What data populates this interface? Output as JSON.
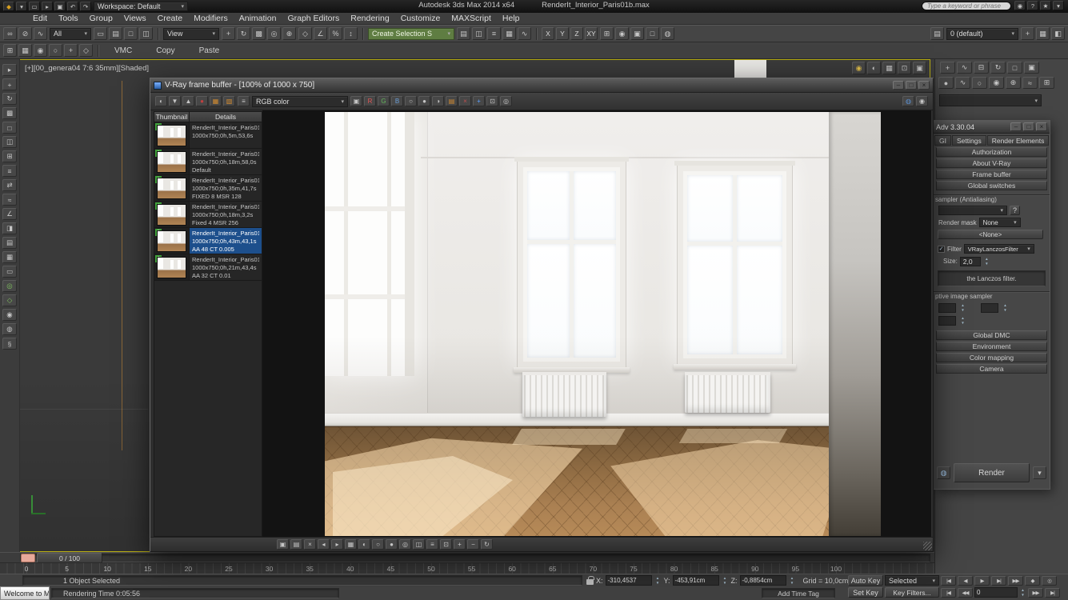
{
  "colors": {
    "viewport_active_border": "#b9ae12",
    "selection_highlight": "#1d4f8c",
    "history_badge": "#3fa03a",
    "time_slider_handle": "#e8a99a",
    "selection_set_green": "#5f7d42"
  },
  "titlebar": {
    "app_title": "Autodesk 3ds Max 2014 x64",
    "doc_title": "RenderIt_Interior_Paris01b.max",
    "workspace_label": "Workspace: Default",
    "search_placeholder": "Type a keyword or phrase",
    "quick_icons": [
      {
        "n": "max-logo-icon",
        "g": "◆",
        "c": "#d8a020"
      },
      {
        "n": "app-menu-arrow-icon",
        "g": "▾"
      },
      {
        "n": "new-scene-icon",
        "g": "▭"
      },
      {
        "n": "open-file-icon",
        "g": "▸"
      },
      {
        "n": "save-file-icon",
        "g": "▣"
      },
      {
        "n": "undo-icon",
        "g": "↶"
      },
      {
        "n": "redo-icon",
        "g": "↷"
      }
    ],
    "right_icons": [
      {
        "n": "sign-in-icon",
        "g": "◉"
      },
      {
        "n": "help-icon",
        "g": "?"
      },
      {
        "n": "favorites-icon",
        "g": "★"
      },
      {
        "n": "notifications-icon",
        "g": "▾"
      }
    ]
  },
  "menus": [
    "Edit",
    "Tools",
    "Group",
    "Views",
    "Create",
    "Modifiers",
    "Animation",
    "Graph Editors",
    "Rendering",
    "Customize",
    "MAXScript",
    "Help"
  ],
  "toolbar1": {
    "filter_dropdown": "All",
    "ref_coord_dropdown": "View",
    "selection_set_dropdown": "Create Selection S",
    "layer_dropdown": "0 (default)",
    "axis_buttons": [
      "X",
      "Y",
      "Z",
      "XY"
    ],
    "icons_a": [
      {
        "n": "select-and-link-icon",
        "g": "∞"
      },
      {
        "n": "unlink-selection-icon",
        "g": "⊘"
      },
      {
        "n": "bind-to-space-warp-icon",
        "g": "∿"
      }
    ],
    "icons_b": [
      {
        "n": "select-object-icon",
        "g": "▭"
      },
      {
        "n": "select-by-name-icon",
        "g": "▤"
      },
      {
        "n": "selection-region-icon",
        "g": "□"
      },
      {
        "n": "window-crossing-icon",
        "g": "◫"
      }
    ],
    "icons_c": [
      {
        "n": "select-and-move-icon",
        "g": "+"
      },
      {
        "n": "select-and-rotate-icon",
        "g": "↻"
      },
      {
        "n": "select-and-scale-icon",
        "g": "▩"
      },
      {
        "n": "use-pivot-center-icon",
        "g": "◎"
      },
      {
        "n": "select-and-manipulate-icon",
        "g": "⊕"
      }
    ],
    "icons_snap": [
      {
        "n": "snaps-toggle-icon",
        "g": "◇"
      },
      {
        "n": "angle-snap-icon",
        "g": "∠"
      },
      {
        "n": "percent-snap-icon",
        "g": "%"
      },
      {
        "n": "spinner-snap-icon",
        "g": "↕"
      }
    ],
    "icons_mid": [
      {
        "n": "edit-named-sets-icon",
        "g": "▤"
      },
      {
        "n": "mirror-icon",
        "g": "◫"
      },
      {
        "n": "align-icon",
        "g": "≡"
      },
      {
        "n": "layer-manager-icon",
        "g": "▦"
      },
      {
        "n": "curve-editor-icon",
        "g": "∿"
      }
    ],
    "icons_post": [
      {
        "n": "schematic-view-icon",
        "g": "⊞"
      },
      {
        "n": "material-editor-icon",
        "g": "◉"
      },
      {
        "n": "render-setup-icon",
        "g": "▣"
      },
      {
        "n": "render-frame-window-icon",
        "g": "□"
      },
      {
        "n": "render-production-icon",
        "g": "◍"
      }
    ],
    "right_icons_a": [
      {
        "n": "layer-list-icon",
        "g": "▤"
      }
    ],
    "right_icons_b": [
      {
        "n": "add-layer-icon",
        "g": "+"
      },
      {
        "n": "layer-properties-icon",
        "g": "▦"
      },
      {
        "n": "toggle-layer-icon",
        "g": "◧"
      }
    ]
  },
  "toolbar2": {
    "buttons": [
      "VMC",
      "Copy",
      "Paste"
    ],
    "icons": [
      {
        "n": "viewport-layout-icon",
        "g": "⊞"
      },
      {
        "n": "show-grid-icon",
        "g": "▦"
      },
      {
        "n": "camera-icon",
        "g": "◉"
      },
      {
        "n": "light-icon",
        "g": "○"
      },
      {
        "n": "helper-icon",
        "g": "+"
      },
      {
        "n": "systems-icon",
        "g": "◇"
      }
    ]
  },
  "leftstrip": {
    "icons": [
      {
        "n": "select-icon",
        "g": "▸"
      },
      {
        "n": "move-icon",
        "g": "+"
      },
      {
        "n": "rotate-icon",
        "g": "↻"
      },
      {
        "n": "scale-icon",
        "g": "▩"
      },
      {
        "n": "region-icon",
        "g": "□"
      },
      {
        "n": "mirror-icon",
        "g": "◫"
      },
      {
        "n": "array-icon",
        "g": "⊞"
      },
      {
        "n": "spacing-icon",
        "g": "≡"
      },
      {
        "n": "align-icon",
        "g": "⇄"
      },
      {
        "n": "quick-align-icon",
        "g": "≈"
      },
      {
        "n": "angle-icon",
        "g": "∠"
      },
      {
        "n": "clone-icon",
        "g": "◨"
      },
      {
        "n": "layers-icon",
        "g": "▤"
      },
      {
        "n": "ribbon-icon",
        "g": "▦"
      },
      {
        "n": "named-selection-icon",
        "g": "▭"
      },
      {
        "n": "isolate-icon",
        "g": "◎",
        "c": "#7fbf5f"
      },
      {
        "n": "snaps-icon",
        "g": "◇",
        "c": "#7fbf5f"
      },
      {
        "n": "material-icon",
        "g": "◉"
      },
      {
        "n": "render-icon",
        "g": "◍"
      },
      {
        "n": "script-icon",
        "g": "§"
      }
    ]
  },
  "viewport": {
    "label": "[+][00_genera04 7:6 35mm][Shaded]",
    "corner_icons": [
      {
        "n": "sun-light-icon",
        "g": "◉",
        "c": "#e0be4a"
      },
      {
        "n": "shading-quality-icon",
        "g": "◐"
      },
      {
        "n": "display-performance-icon",
        "g": "▦"
      },
      {
        "n": "gpu-icon",
        "g": "⊡"
      },
      {
        "n": "viewport-settings-icon",
        "g": "▣"
      }
    ]
  },
  "cmdpanel": {
    "tab_icons": [
      {
        "n": "create-tab-icon",
        "g": "+"
      },
      {
        "n": "modify-tab-icon",
        "g": "∿"
      },
      {
        "n": "hierarchy-tab-icon",
        "g": "⊟"
      },
      {
        "n": "motion-tab-icon",
        "g": "↻"
      },
      {
        "n": "display-tab-icon",
        "g": "□"
      },
      {
        "n": "utilities-tab-icon",
        "g": "▣"
      }
    ],
    "sub_icons": [
      {
        "n": "geometry-icon",
        "g": "●"
      },
      {
        "n": "shapes-icon",
        "g": "∿"
      },
      {
        "n": "lights-icon",
        "g": "○"
      },
      {
        "n": "cameras-icon",
        "g": "◉"
      },
      {
        "n": "helpers-icon",
        "g": "⊕"
      },
      {
        "n": "space-warps-icon",
        "g": "≈"
      },
      {
        "n": "systems-icon",
        "g": "⊞"
      }
    ]
  },
  "vfb": {
    "title": "V-Ray frame buffer - [100% of 1000 x 750]",
    "window_icons": [
      {
        "n": "minimize-icon",
        "g": "–"
      },
      {
        "n": "maximize-icon",
        "g": "□"
      },
      {
        "n": "close-icon",
        "g": "×"
      }
    ],
    "menu_icon": [
      {
        "n": "vfb-menu-icon",
        "g": "≡"
      }
    ],
    "channel_dropdown": "RGB color",
    "icons_a": [
      {
        "n": "half-resolution-icon",
        "g": "◐"
      },
      {
        "n": "save-image-icon",
        "g": "▼"
      },
      {
        "n": "load-image-icon",
        "g": "▲"
      },
      {
        "n": "clear-image-icon",
        "g": "●",
        "c": "#c04040"
      },
      {
        "n": "duplicate-to-host-icon",
        "g": "▦",
        "c": "#d08a30"
      },
      {
        "n": "copy-buffer-icon",
        "g": "▧",
        "c": "#d08a30"
      }
    ],
    "icons_b": [
      {
        "n": "color-swatch-icon",
        "g": "▣"
      },
      {
        "n": "red-channel-icon",
        "g": "R",
        "c": "#e05555"
      },
      {
        "n": "green-channel-icon",
        "g": "G",
        "c": "#62b55a"
      },
      {
        "n": "blue-channel-icon",
        "g": "B",
        "c": "#6a9fd8"
      },
      {
        "n": "white-level-icon",
        "g": "○"
      },
      {
        "n": "black-level-icon",
        "g": "●"
      },
      {
        "n": "monochrome-icon",
        "g": "◑"
      },
      {
        "n": "save-channels-icon",
        "g": "▤",
        "c": "#d08a30"
      },
      {
        "n": "clear-buffer-icon",
        "g": "×",
        "c": "#c05050"
      },
      {
        "n": "track-mouse-icon",
        "g": "+",
        "c": "#5aa0ff"
      },
      {
        "n": "region-render-icon",
        "g": "⊡"
      },
      {
        "n": "pixel-info-icon",
        "g": "◎"
      }
    ],
    "icons_right": [
      {
        "n": "color-corrections-icon",
        "g": "◍",
        "c": "#5a8fd0"
      },
      {
        "n": "show-corrections-icon",
        "g": "◉"
      }
    ],
    "bottom_icons": [
      {
        "n": "save-icon",
        "g": "▣"
      },
      {
        "n": "load-icon",
        "g": "▤"
      },
      {
        "n": "clear-icon",
        "g": "×"
      },
      {
        "n": "prev-icon",
        "g": "◂"
      },
      {
        "n": "next-icon",
        "g": "▸"
      },
      {
        "n": "histogram-icon",
        "g": "▦"
      },
      {
        "n": "exposure-icon",
        "g": "◐"
      },
      {
        "n": "white-balance-icon",
        "g": "○"
      },
      {
        "n": "black-level-icon",
        "g": "●"
      },
      {
        "n": "pixel-info-icon",
        "g": "◎"
      },
      {
        "n": "compare-icon",
        "g": "◫"
      },
      {
        "n": "stamp-icon",
        "g": "≡"
      },
      {
        "n": "crop-icon",
        "g": "⊡"
      },
      {
        "n": "zoom-in-icon",
        "g": "+"
      },
      {
        "n": "zoom-out-icon",
        "g": "−"
      },
      {
        "n": "reset-view-icon",
        "g": "↻"
      }
    ],
    "history": {
      "columns": [
        "Thumbnail",
        "Details"
      ],
      "rows": [
        {
          "index": "1",
          "name": "RenderIt_Interior_Paris01",
          "line2": "1000x750;0h,5m,53,6s",
          "line3": "",
          "selected": false
        },
        {
          "index": "2",
          "name": "RenderIt_Interior_Paris01",
          "line2": "1000x750;0h,18m,58,0s",
          "line3": "Default",
          "selected": false
        },
        {
          "index": "3",
          "name": "RenderIt_Interior_Paris01",
          "line2": "1000x750;0h,35m,41,7s",
          "line3": "FIXED 8 MSR 128",
          "selected": false
        },
        {
          "index": "4",
          "name": "RenderIt_Interior_Paris01",
          "line2": "1000x750;0h,18m,3,2s",
          "line3": "Fixed 4 MSR 256",
          "selected": false
        },
        {
          "index": "5",
          "name": "RenderIt_Interior_Paris01",
          "line2": "1000x750;0h,43m,43,1s",
          "line3": "AA 48 CT 0.005",
          "selected": true
        },
        {
          "index": "6",
          "name": "RenderIt_Interior_Paris01",
          "line2": "1000x750;0h,21m,43,4s",
          "line3": "AA 32 CT 0.01",
          "selected": false
        }
      ]
    }
  },
  "vray_panel": {
    "title": "Adv 3.30.04",
    "window_icons": [
      {
        "n": "minimize-icon",
        "g": "–"
      },
      {
        "n": "maximize-icon",
        "g": "□"
      },
      {
        "n": "close-icon",
        "g": "×"
      }
    ],
    "tabs": [
      "GI",
      "Settings",
      "Render Elements"
    ],
    "rollouts_top": [
      "Authorization",
      "About V-Ray",
      "Frame buffer",
      "Global switches"
    ],
    "sampler_section": "sampler (Antialiasing)",
    "help_button": "?",
    "render_mask_label": "Render mask",
    "render_mask_value": "None",
    "none_value": "<None>",
    "filter_label": "Filter",
    "filter_value": "VRayLanczosFilter",
    "size_label": "Size:",
    "size_value": "2,0",
    "filter_desc": "the Lanczos filter.",
    "adaptive_section": "ptive image sampler",
    "rollouts_bottom": [
      "Global DMC",
      "Environment",
      "Color mapping",
      "Camera"
    ],
    "render_button": "Render",
    "render_icon": [
      {
        "n": "render-production-icon",
        "g": "◍",
        "c": "#9fc4e8"
      }
    ],
    "render_arrow": [
      {
        "n": "render-mode-arrow-icon",
        "g": "▾"
      }
    ]
  },
  "timeline": {
    "slider_label": "0 / 100",
    "ticks": [
      "0",
      "5",
      "10",
      "15",
      "20",
      "25",
      "30",
      "35",
      "40",
      "45",
      "50",
      "55",
      "60",
      "65",
      "70",
      "75",
      "80",
      "85",
      "90",
      "95",
      "100"
    ]
  },
  "statusbar": {
    "selected_text": "1 Object Selected",
    "welcome_title": "Welcome to M",
    "prompt_text": "Rendering Time 0:05:56",
    "x_label": "X:",
    "x_value": "-310,4537",
    "y_label": "Y:",
    "y_value": "-453,91cm",
    "z_label": "Z:",
    "z_value": "-0,8854cm",
    "grid_text": "Grid = 10,0cm",
    "add_time_tag": "Add Time Tag",
    "auto_key": "Auto Key",
    "set_key": "Set Key",
    "selected_dropdown": "Selected",
    "key_filters": "Key Filters...",
    "frame_value": "0",
    "transport_a": [
      {
        "n": "go-to-start-icon",
        "g": "|◀"
      },
      {
        "n": "previous-frame-icon",
        "g": "◀"
      },
      {
        "n": "play-icon",
        "g": "▶"
      },
      {
        "n": "next-frame-icon",
        "g": "▶|"
      },
      {
        "n": "go-to-end-icon",
        "g": "▶▶"
      }
    ],
    "extra_a": [
      {
        "n": "key-mode-icon",
        "g": "◆"
      },
      {
        "n": "time-config-icon",
        "g": "◎"
      }
    ],
    "transport_b_left": [
      {
        "n": "go-to-start-icon",
        "g": "|◀"
      },
      {
        "n": "rewind-icon",
        "g": "◀◀"
      }
    ],
    "transport_b_right": [
      {
        "n": "fast-forward-icon",
        "g": "▶▶"
      },
      {
        "n": "go-to-end-icon",
        "g": "▶|"
      }
    ]
  }
}
